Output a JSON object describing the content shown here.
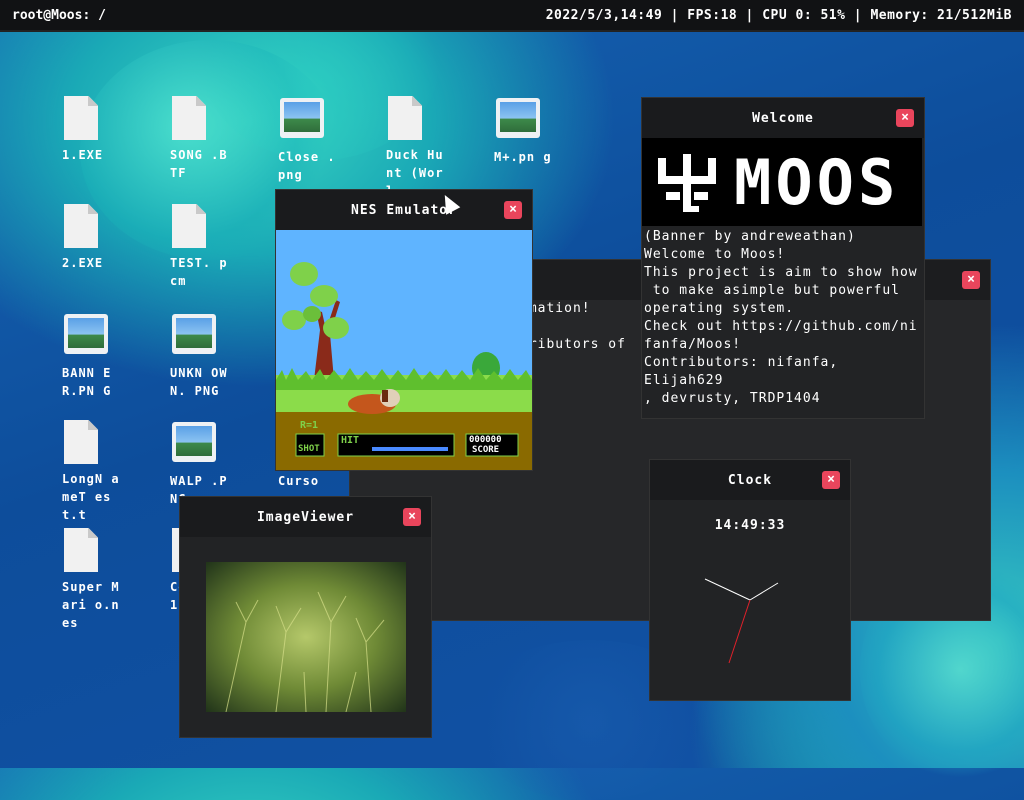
{
  "topbar": {
    "left": "root@Moos: /",
    "right": "2022/5/3,14:49 | FPS:18 | CPU 0: 51% | Memory: 21/512MiB"
  },
  "desktop_icons": [
    {
      "label": "1.EXE",
      "icon": "file-icon"
    },
    {
      "label": "SONG .BTF",
      "icon": "file-icon"
    },
    {
      "label": "Close .png",
      "icon": "image-icon"
    },
    {
      "label": "Duck Hunt (Worl",
      "icon": "file-icon"
    },
    {
      "label": "M+.pn g",
      "icon": "image-icon"
    },
    {
      "label": "2.EXE",
      "icon": "file-icon"
    },
    {
      "label": "TEST. pcm",
      "icon": "file-icon"
    },
    {
      "label": "BANN ER.PN G",
      "icon": "image-icon"
    },
    {
      "label": "UNKN OWN. PNG",
      "icon": "image-icon"
    },
    {
      "label": "LongN ameT est.t",
      "icon": "file-icon"
    },
    {
      "label": "WALP .PNG",
      "icon": "image-icon"
    },
    {
      "label": "Curso r.png",
      "icon": "image-icon"
    },
    {
      "label": "Super Mari o.nes",
      "icon": "file-icon"
    },
    {
      "label": "Co le 1.",
      "icon": "file-icon"
    }
  ],
  "windows": {
    "info": {
      "lines": "rmation!\n\ntributors of\n!"
    },
    "welcome": {
      "title": "Welcome",
      "banner_word": "MOOS",
      "text": "(Banner by andreweathan)\nWelcome to Moos!\nThis project is aim to show how\n to make asimple but powerful\noperating system.\nCheck out https://github.com/ni\nfanfa/Moos!\nContributors: nifanfa, Elijah629\n, devrusty, TRDP1404"
    },
    "nes": {
      "title": "NES Emulator",
      "hud_round": "R=1",
      "hud_shot": "SHOT",
      "hud_hit": "HIT",
      "hud_score_value": "000000",
      "hud_score": "SCORE"
    },
    "clock": {
      "title": "Clock",
      "time": "14:49:33"
    },
    "image_viewer": {
      "title": "ImageViewer"
    }
  },
  "close_glyph": "×",
  "colors": {
    "close_button": "#e9455c",
    "window_bg": "#222325",
    "topbar_bg": "#111214"
  }
}
